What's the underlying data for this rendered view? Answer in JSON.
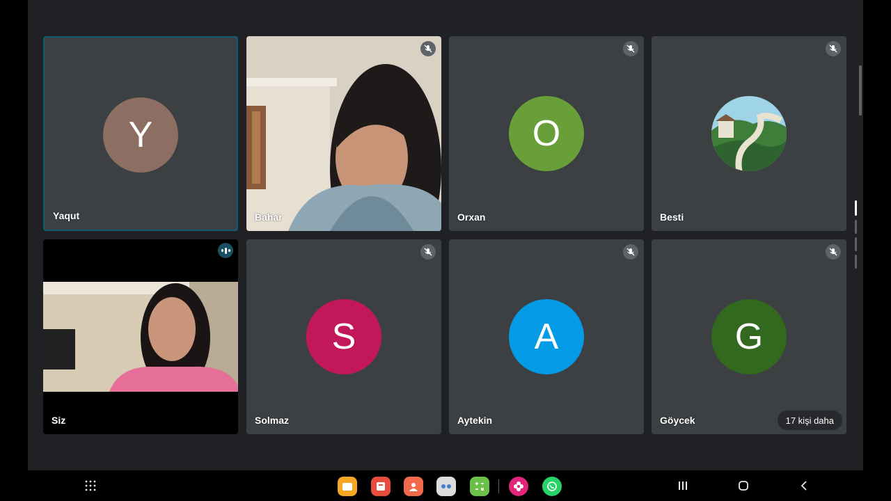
{
  "participants": [
    {
      "name": "Yaqut",
      "initial": "Y",
      "color": "#8d6e63"
    },
    {
      "name": "Bahar",
      "initial": "",
      "color": ""
    },
    {
      "name": "Orxan",
      "initial": "O",
      "color": "#689f38"
    },
    {
      "name": "Besti",
      "initial": "",
      "color": ""
    },
    {
      "name": "Siz",
      "initial": "",
      "color": ""
    },
    {
      "name": "Solmaz",
      "initial": "S",
      "color": "#c2185b"
    },
    {
      "name": "Aytekin",
      "initial": "A",
      "color": "#039be5"
    },
    {
      "name": "Göycek",
      "initial": "G",
      "color": "#33691e"
    }
  ],
  "more_participants_label": "17 kişi daha",
  "taskbar": {
    "apps": [
      "files-app-icon",
      "notes-app-icon",
      "contacts-app-icon",
      "camera-app-icon",
      "calculator-app-icon",
      "gallery-app-icon",
      "whatsapp-app-icon"
    ]
  }
}
